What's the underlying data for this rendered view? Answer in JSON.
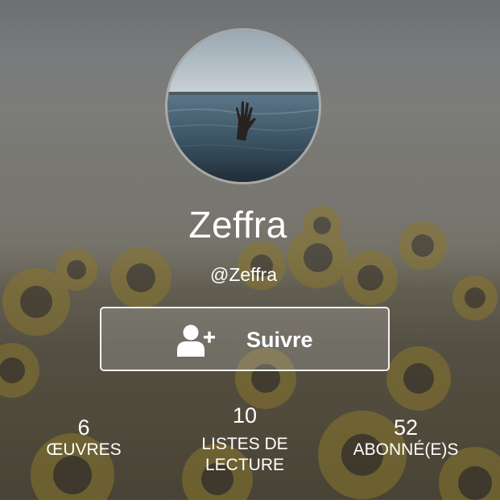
{
  "profile": {
    "display_name": "Zeffra",
    "username": "@Zeffra",
    "avatar_description": "hand-in-water"
  },
  "follow_button": {
    "label": "Suivre",
    "icon": "add-user-icon"
  },
  "stats": [
    {
      "value": "6",
      "label": "ŒUVRES"
    },
    {
      "value": "10",
      "label": "LISTES DE LECTURE"
    },
    {
      "value": "52",
      "label": "ABONNÉ(E)S"
    }
  ],
  "colors": {
    "text": "#ffffff",
    "button_border": "#ffffff",
    "background_sky": "#8c8e8f",
    "background_flowers": "#5e5849"
  }
}
